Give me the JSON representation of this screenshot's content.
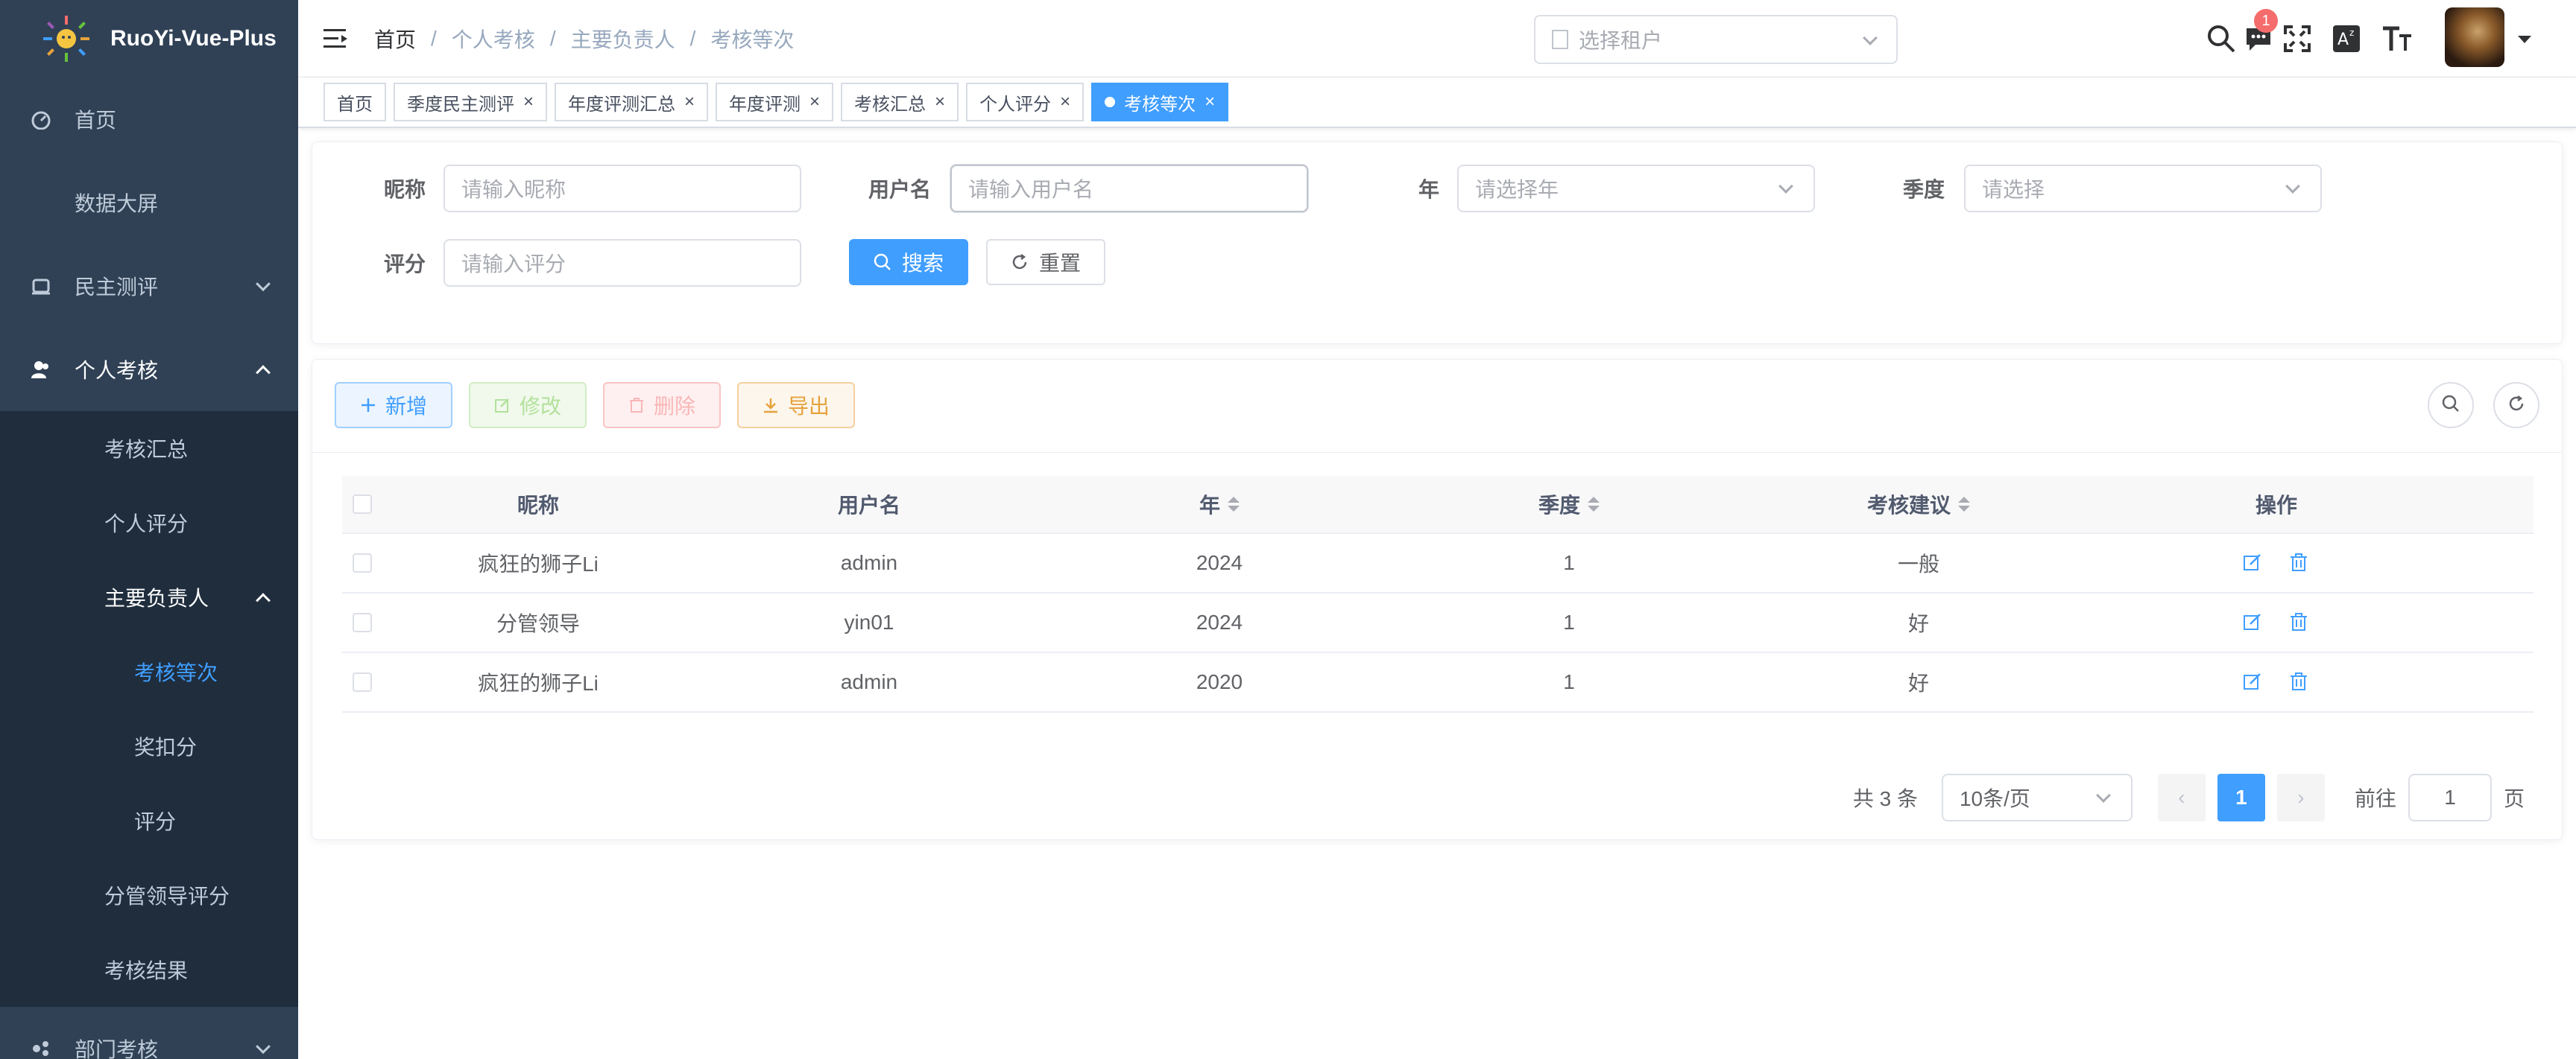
{
  "app": {
    "title": "RuoYi-Vue-Plus"
  },
  "sidebar": {
    "items": [
      {
        "label": "首页",
        "icon": "dashboard-icon"
      },
      {
        "label": "数据大屏"
      },
      {
        "label": "民主测评",
        "icon": "vote-icon",
        "expanded": false
      },
      {
        "label": "个人考核",
        "icon": "user-icon",
        "expanded": true,
        "children": [
          {
            "label": "考核汇总"
          },
          {
            "label": "个人评分"
          },
          {
            "label": "主要负责人",
            "expanded": true,
            "children": [
              {
                "label": "考核等次",
                "active": true
              },
              {
                "label": "奖扣分"
              },
              {
                "label": "评分"
              }
            ]
          },
          {
            "label": "分管领导评分"
          },
          {
            "label": "考核结果"
          }
        ]
      },
      {
        "label": "部门考核",
        "icon": "department-icon",
        "expanded": false
      }
    ]
  },
  "header": {
    "breadcrumb": [
      "首页",
      "个人考核",
      "主要负责人",
      "考核等次"
    ],
    "tenant_placeholder": "选择租户",
    "message_count": "1"
  },
  "tags": [
    {
      "label": "首页",
      "closable": false
    },
    {
      "label": "季度民主测评",
      "closable": true
    },
    {
      "label": "年度评测汇总",
      "closable": true
    },
    {
      "label": "年度评测",
      "closable": true
    },
    {
      "label": "考核汇总",
      "closable": true
    },
    {
      "label": "个人评分",
      "closable": true
    },
    {
      "label": "考核等次",
      "closable": true,
      "active": true
    }
  ],
  "search": {
    "nickname": {
      "label": "昵称",
      "placeholder": "请输入昵称"
    },
    "username": {
      "label": "用户名",
      "placeholder": "请输入用户名"
    },
    "year": {
      "label": "年",
      "placeholder": "请选择年"
    },
    "quarter": {
      "label": "季度",
      "placeholder": "请选择"
    },
    "score": {
      "label": "评分",
      "placeholder": "请输入评分"
    },
    "search_btn": "搜索",
    "reset_btn": "重置"
  },
  "toolbar": {
    "add": "新增",
    "edit": "修改",
    "delete": "删除",
    "export": "导出"
  },
  "table": {
    "columns": [
      "昵称",
      "用户名",
      "年",
      "季度",
      "考核建议",
      "操作"
    ],
    "rows": [
      {
        "nickname": "疯狂的狮子Li",
        "username": "admin",
        "year": "2024",
        "quarter": "1",
        "suggestion": "一般"
      },
      {
        "nickname": "分管领导",
        "username": "yin01",
        "year": "2024",
        "quarter": "1",
        "suggestion": "好"
      },
      {
        "nickname": "疯狂的狮子Li",
        "username": "admin",
        "year": "2020",
        "quarter": "1",
        "suggestion": "好"
      }
    ]
  },
  "pagination": {
    "total_text": "共 3 条",
    "page_size": "10条/页",
    "current_page": "1",
    "goto_label": "前往",
    "goto_value": "1",
    "page_unit": "页"
  },
  "colors": {
    "sidebar_bg": "#304156",
    "submenu_bg": "#1f2d3d",
    "primary": "#409eff",
    "badge": "#f56c6c"
  }
}
